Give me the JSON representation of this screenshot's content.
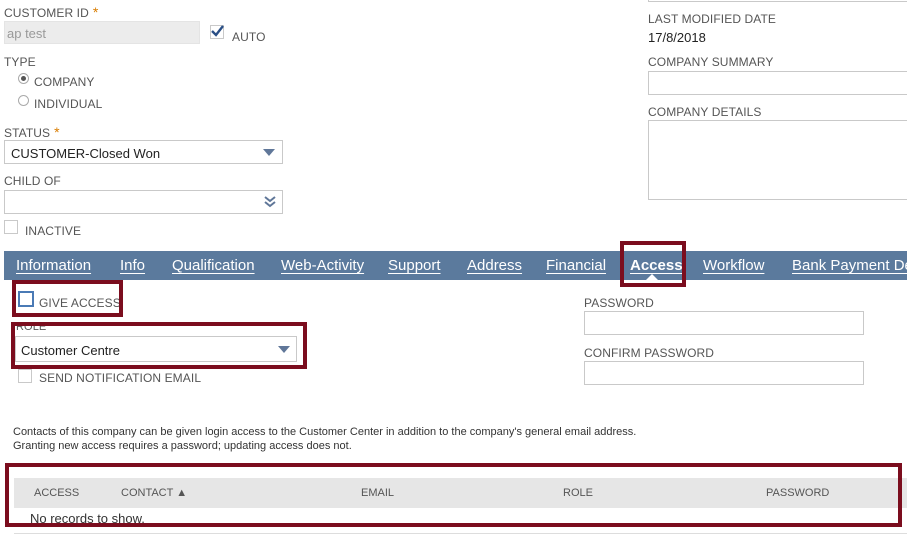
{
  "customer_id": {
    "label": "CUSTOMER ID",
    "value": "ap test",
    "auto_label": "AUTO",
    "auto_checked": true
  },
  "type": {
    "label": "TYPE",
    "options": [
      "COMPANY",
      "INDIVIDUAL"
    ],
    "selected": "COMPANY"
  },
  "status": {
    "label": "STATUS",
    "value": "CUSTOMER-Closed Won"
  },
  "child_of": {
    "label": "CHILD OF",
    "value": ""
  },
  "inactive": {
    "label": "INACTIVE",
    "checked": false
  },
  "last_modified": {
    "label": "LAST MODIFIED DATE",
    "value": "17/8/2018"
  },
  "company_summary": {
    "label": "COMPANY SUMMARY"
  },
  "company_details": {
    "label": "COMPANY DETAILS"
  },
  "tabs": [
    {
      "label": "Information"
    },
    {
      "label": "Info"
    },
    {
      "label": "Qualification"
    },
    {
      "label": "Web-Activity"
    },
    {
      "label": "Support"
    },
    {
      "label": "Address"
    },
    {
      "label": "Financial"
    },
    {
      "label": "Access",
      "active": true
    },
    {
      "label": "Workflow"
    },
    {
      "label": "Bank Payment De"
    }
  ],
  "access": {
    "give_access_label": "GIVE ACCESS",
    "role_label": "ROLE",
    "role_value": "Customer Centre",
    "send_notification_label": "SEND NOTIFICATION EMAIL",
    "password_label": "PASSWORD",
    "confirm_password_label": "CONFIRM PASSWORD",
    "info_line1": "Contacts of this company can be given login access to the Customer Center in addition to the company's general email address.",
    "info_line2": "Granting new access requires a password; updating access does not."
  },
  "contacts_table": {
    "columns": [
      "ACCESS",
      "CONTACT ▲",
      "EMAIL",
      "ROLE",
      "PASSWORD"
    ],
    "empty_text": "No records to show."
  },
  "colors": {
    "tab_bar": "#5b7a9d",
    "highlight_box": "#7b0d1e",
    "required": "#d97c00"
  }
}
